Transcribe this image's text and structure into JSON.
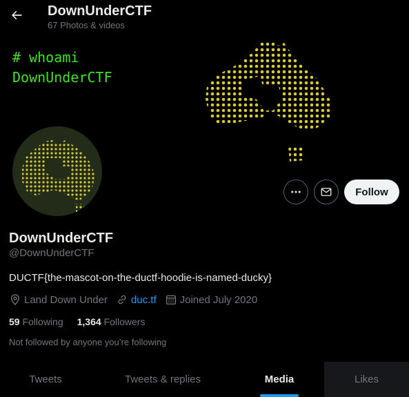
{
  "header": {
    "title": "DownUnderCTF",
    "subtitle": "67 Photos & videos"
  },
  "banner": {
    "line1": "# whoami",
    "line2": "DownUnderCTF",
    "text_color": "#39e61b",
    "map_color": "#d8c935"
  },
  "profile": {
    "name": "DownUnderCTF",
    "handle": "@DownUnderCTF",
    "bio": "DUCTF{the-mascot-on-the-ductf-hoodie-is-named-ducky}",
    "location": "Land Down Under",
    "website": "duc.tf",
    "joined": "Joined July 2020",
    "following_count": "59",
    "following_label": "Following",
    "followers_count": "1,364",
    "followers_label": "Followers",
    "followed_note": "Not followed by anyone you’re following"
  },
  "actions": {
    "more_icon": "more-icon",
    "message_icon": "envelope-icon",
    "follow_label": "Follow"
  },
  "tabs": [
    {
      "label": "Tweets"
    },
    {
      "label": "Tweets & replies"
    },
    {
      "label": "Media",
      "active": true
    },
    {
      "label": "Likes"
    }
  ],
  "colors": {
    "accent": "#1d9bf0",
    "background": "#000000",
    "muted": "#71767b"
  }
}
